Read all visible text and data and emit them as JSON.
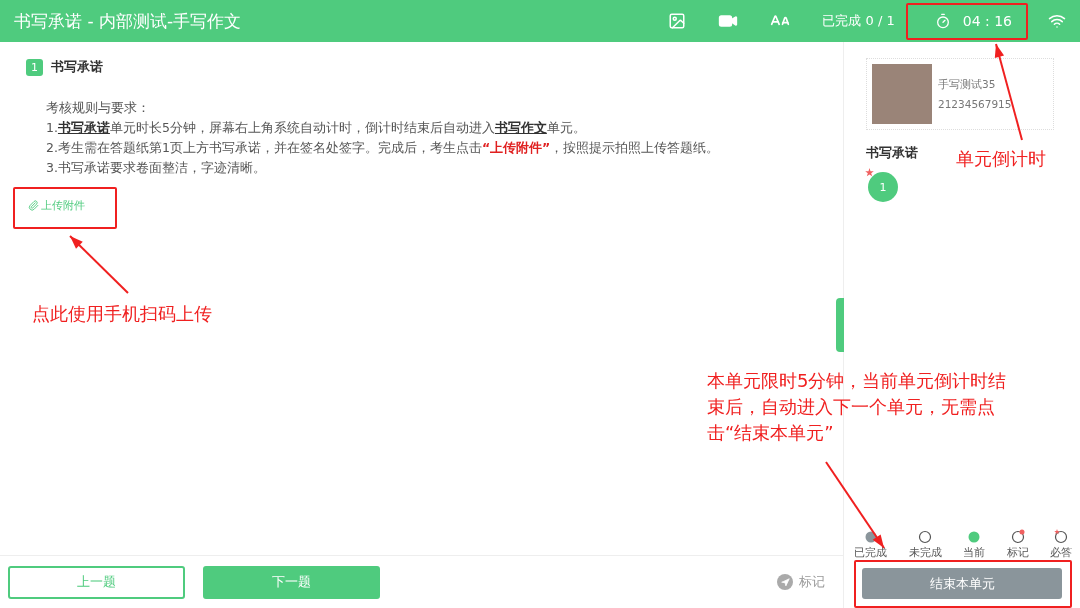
{
  "header": {
    "title": "书写承诺 - 内部测试-手写作文",
    "progress": "已完成 0 / 1",
    "timer": "04 : 16"
  },
  "question": {
    "number": "1",
    "title": "书写承诺",
    "intro": "考核规则与要求：",
    "rules": [
      [
        {
          "text": "1.",
          "kind": "plain"
        },
        {
          "text": "书写承诺",
          "kind": "link"
        },
        {
          "text": "单元时长5分钟，屏幕右上角系统自动计时，倒计时结束后自动进入",
          "kind": "plain"
        },
        {
          "text": "书写作文",
          "kind": "link"
        },
        {
          "text": "单元。",
          "kind": "plain"
        }
      ],
      [
        {
          "text": "2.考生需在答题纸第1页上方书写承诺，并在签名处签字。完成后，考生点击",
          "kind": "plain"
        },
        {
          "text": "“上传附件”",
          "kind": "alert"
        },
        {
          "text": "，按照提示拍照上传答题纸。",
          "kind": "plain"
        }
      ],
      [
        {
          "text": "3.书写承诺要求卷面整洁，字迹清晰。",
          "kind": "plain"
        }
      ]
    ],
    "upload": "上传附件"
  },
  "footer": {
    "prev": "上一题",
    "next": "下一题",
    "mark": "标记"
  },
  "sidebar": {
    "name": "手写测试35",
    "id": "21234567915",
    "section": "书写承诺",
    "questions": [
      {
        "number": "1",
        "kind": "current",
        "required": true
      }
    ],
    "legend": [
      {
        "kind": "done",
        "label": "已完成"
      },
      {
        "kind": "todo",
        "label": "未完成"
      },
      {
        "kind": "current",
        "label": "当前"
      },
      {
        "kind": "marked",
        "label": "标记"
      },
      {
        "kind": "required",
        "label": "必答"
      }
    ],
    "end_button": "结束本单元"
  },
  "annotations": {
    "upload_note": "点此使用手机扫码上传",
    "timer_note": "单元倒计时",
    "end_note": "本单元限时5分钟，当前单元倒计时结束后，自动进入下一个单元，无需点击“结束本单元”"
  }
}
